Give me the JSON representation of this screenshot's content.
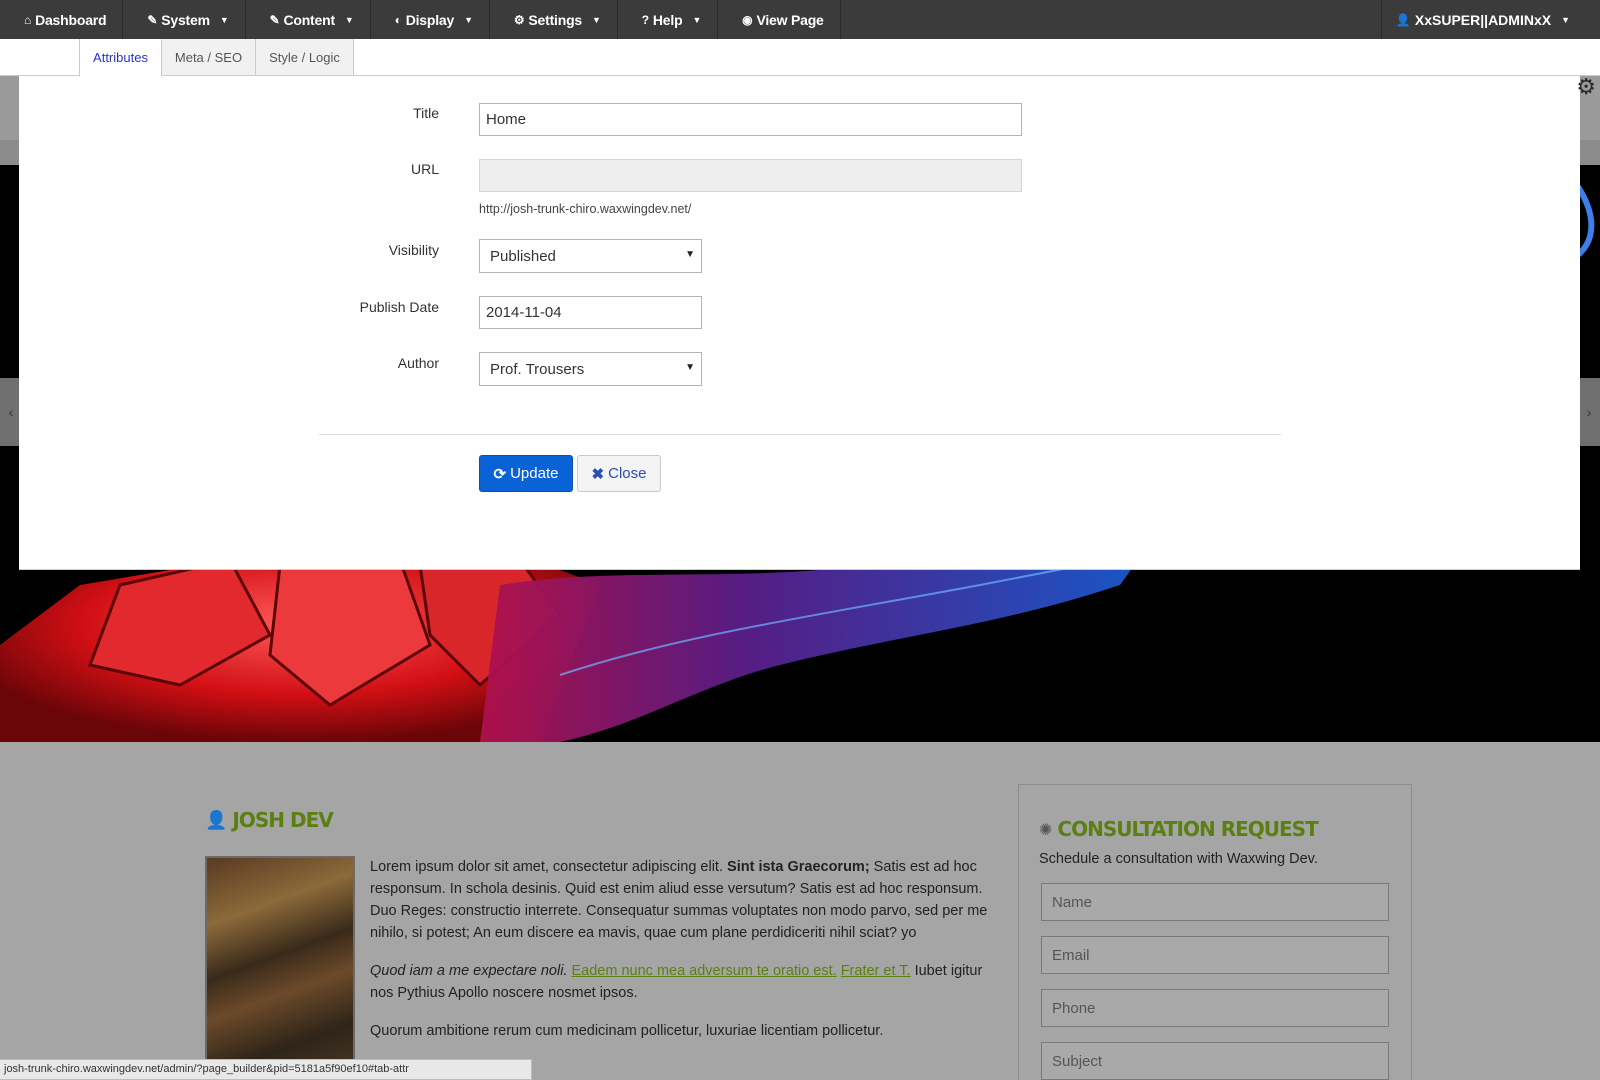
{
  "topbar": {
    "items": [
      {
        "icon": "home-icon",
        "glyph": "⌂",
        "label": "Dashboard",
        "has_caret": false
      },
      {
        "icon": "wrench-icon",
        "glyph": "🔧",
        "label": "System",
        "has_caret": true
      },
      {
        "icon": "edit-icon",
        "glyph": "✎",
        "label": "Content",
        "has_caret": true
      },
      {
        "icon": "contrast-icon",
        "glyph": "◐",
        "label": "Display",
        "has_caret": true
      },
      {
        "icon": "gear-icon",
        "glyph": "⚙",
        "label": "Settings",
        "has_caret": true
      },
      {
        "icon": "question-icon",
        "glyph": "?",
        "label": "Help",
        "has_caret": true
      },
      {
        "icon": "eye-icon",
        "glyph": "◉",
        "label": "View Page",
        "has_caret": false
      }
    ],
    "user_label": "XxSUPER||ADMINxX"
  },
  "tabs": [
    "Attributes",
    "Meta / SEO",
    "Style / Logic"
  ],
  "form": {
    "title_label": "Title",
    "title_value": "Home",
    "url_label": "URL",
    "url_value": "",
    "url_help": "http://josh-trunk-chiro.waxwingdev.net/",
    "visibility_label": "Visibility",
    "visibility_value": "Published",
    "publish_date_label": "Publish Date",
    "publish_date_value": "2014-11-04",
    "author_label": "Author",
    "author_value": "Prof. Trousers",
    "update_label": "Update",
    "close_label": "Close"
  },
  "background_page": {
    "author_heading": "JOSH DEV",
    "article_p1_a": "Lorem ipsum dolor sit amet, consectetur adipiscing elit. ",
    "article_p1_bold": "Sint ista Graecorum;",
    "article_p1_b": " Satis est ad hoc responsum. In schola desinis. Quid est enim aliud esse versutum? Satis est ad hoc responsum. Duo Reges: constructio interrete. Consequatur summas voluptates non modo parvo, sed per me nihilo, si potest; An eum discere ea mavis, quae cum plane perdidiceriti nihil sciat? yo",
    "article_p2_italic": "Quod iam a me expectare noli.",
    "article_p2_link1": "Eadem nunc mea adversum te oratio est.",
    "article_p2_link2": "Frater et T.",
    "article_p2_rest": " Iubet igitur nos Pythius Apollo noscere nosmet ipsos.",
    "article_p3": "Quorum ambitione rerum cum medicinam pollicetur, luxuriae licentiam pollicetur.",
    "consult_title": "CONSULTATION REQUEST",
    "consult_sub": "Schedule a consultation with Waxwing Dev.",
    "fields": [
      "Name",
      "Email",
      "Phone",
      "Subject"
    ]
  },
  "status_url": "josh-trunk-chiro.waxwingdev.net/admin/?page_builder&pid=5181a5f90ef10#tab-attr",
  "colors": {
    "topbar_bg": "#3b3b3b",
    "primary": "#0a63d6",
    "accent_green": "#5b7f10",
    "active_tab_text": "#2a32d6"
  }
}
